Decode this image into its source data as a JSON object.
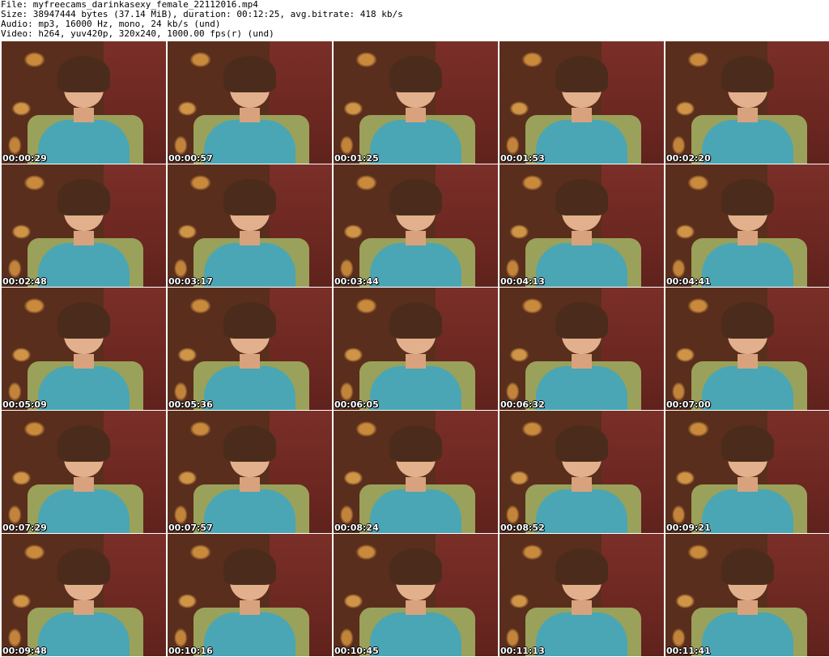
{
  "header": {
    "file_line": "File: myfreecams_darinkasexy_female_22112016.mp4",
    "size_line": "Size: 38947444 bytes (37.14 MiB), duration: 00:12:25, avg.bitrate: 418 kb/s",
    "audio_line": "Audio: mp3, 16000 Hz, mono, 24 kb/s (und)",
    "video_line": "Video: h264, yuv420p, 320x240, 1000.00 fps(r) (und)"
  },
  "thumbnails": [
    "00:00:29",
    "00:00:57",
    "00:01:25",
    "00:01:53",
    "00:02:20",
    "00:02:48",
    "00:03:17",
    "00:03:44",
    "00:04:13",
    "00:04:41",
    "00:05:09",
    "00:05:36",
    "00:06:05",
    "00:06:32",
    "00:07:00",
    "00:07:29",
    "00:07:57",
    "00:08:24",
    "00:08:52",
    "00:09:21",
    "00:09:48",
    "00:10:16",
    "00:10:45",
    "00:11:13",
    "00:11:41"
  ]
}
